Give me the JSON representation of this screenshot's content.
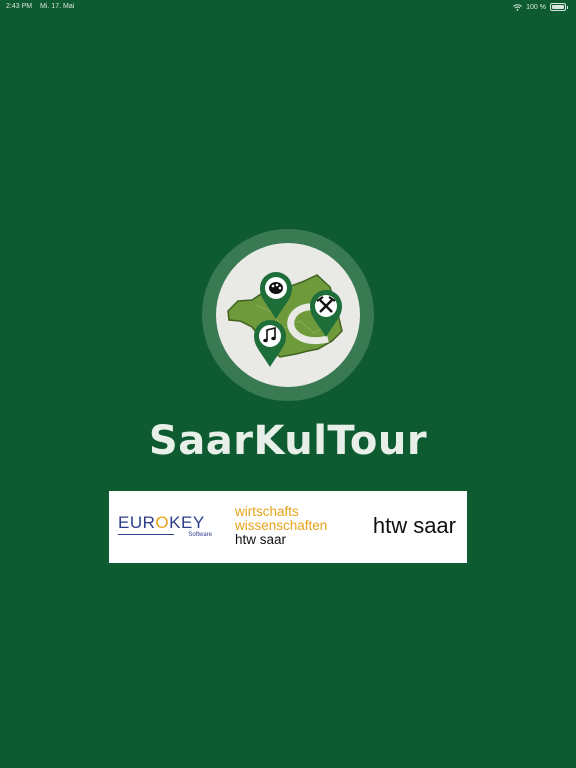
{
  "status_bar": {
    "time": "2:43 PM",
    "date": "Mi. 17. Mai",
    "battery": "100 %",
    "icons": [
      "wifi-icon",
      "battery-icon"
    ]
  },
  "logo": {
    "pins": [
      "palette-icon",
      "hammer-pick-icon",
      "music-note-icon"
    ]
  },
  "app": {
    "title": "SaarKulTour"
  },
  "sponsors": {
    "eurokey_prefix": "EUR",
    "eurokey_o": "O",
    "eurokey_suffix": "KEY",
    "eurokey_sub": "Software",
    "ww_line1": "wirtschafts",
    "ww_line2": "wissenschaften",
    "ww_line3": "htw saar",
    "htw": "htw saar"
  },
  "colors": {
    "background": "#0f5b31",
    "map": "#6f9a3c",
    "pin": "#1e6e3a",
    "eurokey_blue": "#2f3d8a",
    "accent_orange": "#e8a21a"
  }
}
